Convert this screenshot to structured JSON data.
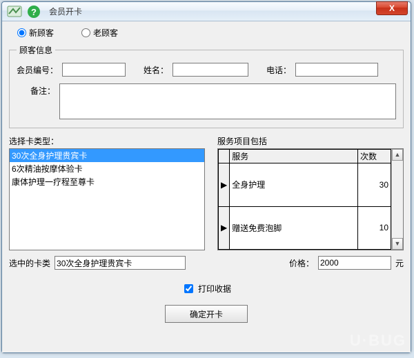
{
  "window": {
    "title": "会员开卡",
    "close_label": "X"
  },
  "customer_type": {
    "new_label": "新顾客",
    "old_label": "老顾客",
    "selected": "new"
  },
  "customer_info": {
    "legend": "顾客信息",
    "member_no_label": "会员编号：",
    "member_no": "",
    "name_label": "姓名：",
    "name": "",
    "phone_label": "电话：",
    "phone": "",
    "remark_label": "备注：",
    "remark": ""
  },
  "card_type": {
    "label": "选择卡类型：",
    "items": [
      {
        "name": "30次全身护理贵宾卡",
        "selected": true
      },
      {
        "name": "6次精油按摩体验卡",
        "selected": false
      },
      {
        "name": "康体护理一疗程至尊卡",
        "selected": false
      }
    ]
  },
  "service": {
    "label": "服务项目包括",
    "col_service": "服务",
    "col_count": "次数",
    "rows": [
      {
        "name": "全身护理",
        "count": 30
      },
      {
        "name": "赠送免费泡脚",
        "count": 10
      }
    ]
  },
  "selected_card": {
    "label": "选中的卡类",
    "value": "30次全身护理贵宾卡"
  },
  "price": {
    "label": "价格：",
    "value": "2000",
    "unit": "元"
  },
  "print_receipt": {
    "label": "打印收据",
    "checked": true
  },
  "confirm_label": "确定开卡",
  "watermark": "U·BUG"
}
